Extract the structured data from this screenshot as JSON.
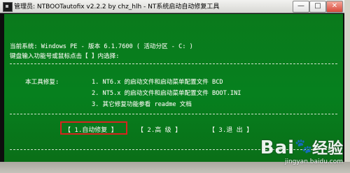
{
  "window": {
    "title": "管理员: NTBOOTautofix v2.2.2 by chz_hlh - NT系统启动自动修复工具",
    "minimize": "—",
    "maximize": "□",
    "close": "✕"
  },
  "console": {
    "system_line": "当前系统: Windows PE - 版本 6.1.7600  ( 活动分区 - C: )",
    "prompt_line": "键盘输入功能号或鼠标点击【 】内选择:",
    "repair_heading": "本工具修复:",
    "items": [
      "1. NT6.x 的启动文件和启动菜单配置文件 BCD",
      "2. NT5.x 的启动文件和启动菜单配置文件 BOOT.INI",
      "3. 其它修复功能参看 readme 文档"
    ]
  },
  "menu": {
    "auto_repair": "【 1.自动修复 】",
    "advanced": "【 2.高  级 】",
    "exit": "【 3.退 出 】"
  },
  "watermark": {
    "brand": "Bai",
    "paw": "🐾",
    "brand_suffix": "经验",
    "url": "jingyan.baidu.com"
  },
  "colors": {
    "console_background": "#06801e",
    "text": "#f4f7ee",
    "highlight_border": "#d8241f"
  }
}
